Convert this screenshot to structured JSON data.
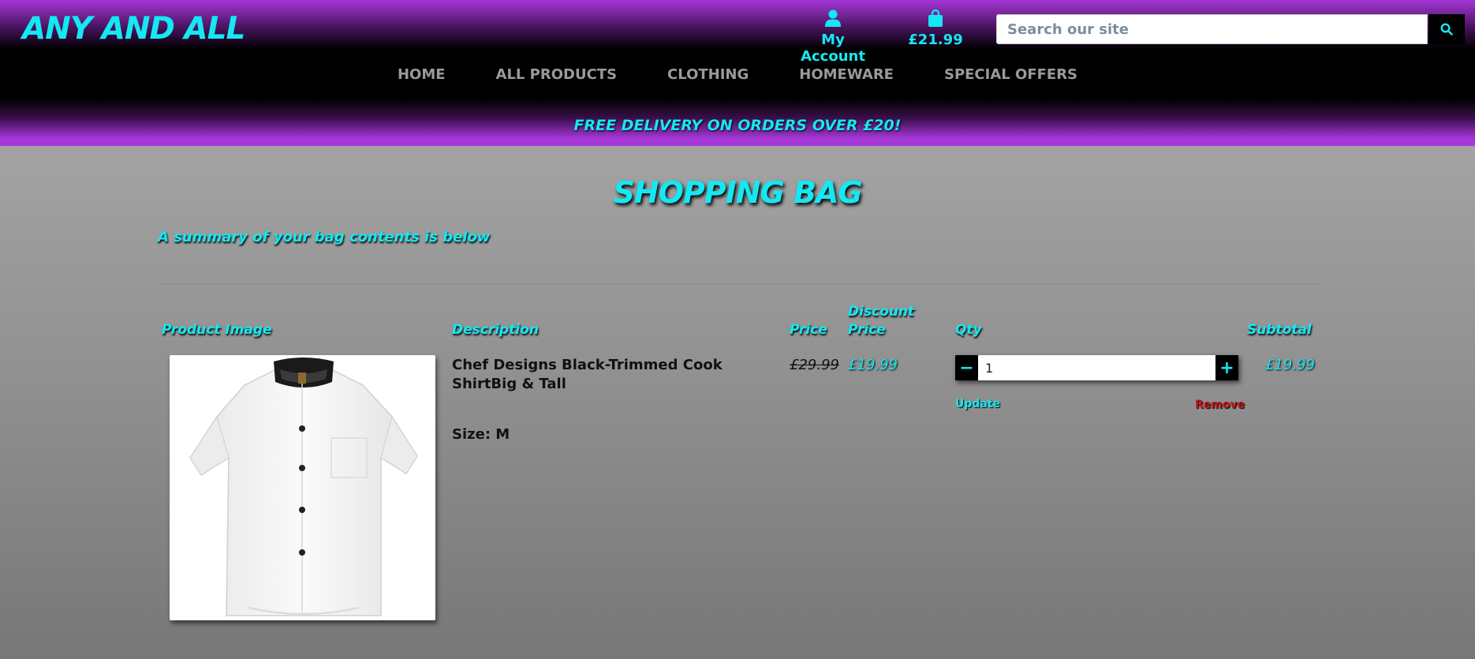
{
  "header": {
    "logo": "ANY AND ALL",
    "account_label": "My Account",
    "bag_total": "£21.99",
    "search_placeholder": "Search our site"
  },
  "nav": {
    "items": [
      "HOME",
      "ALL PRODUCTS",
      "CLOTHING",
      "HOMEWARE",
      "SPECIAL OFFERS"
    ]
  },
  "banner": "FREE DELIVERY ON ORDERS OVER £20!",
  "page": {
    "title": "SHOPPING BAG",
    "summary": "A summary of your bag contents is below"
  },
  "table": {
    "headers": {
      "image": "Product Image",
      "description": "Description",
      "price": "Price",
      "discount_line1": "Discount",
      "discount_line2": "Price",
      "qty": "Qty",
      "subtotal": "Subtotal"
    },
    "rows": [
      {
        "description": "Chef Designs Black-Trimmed Cook ShirtBig & Tall",
        "size": "Size: M",
        "price": "£29.99",
        "discount_price": "£19.99",
        "qty": "1",
        "minus": "−",
        "plus": "+",
        "update": "Update",
        "remove": "Remove",
        "subtotal": "£19.99"
      }
    ]
  },
  "colors": {
    "accent": "#14e8f2",
    "purple": "#a436d6",
    "remove": "#c0161b"
  }
}
